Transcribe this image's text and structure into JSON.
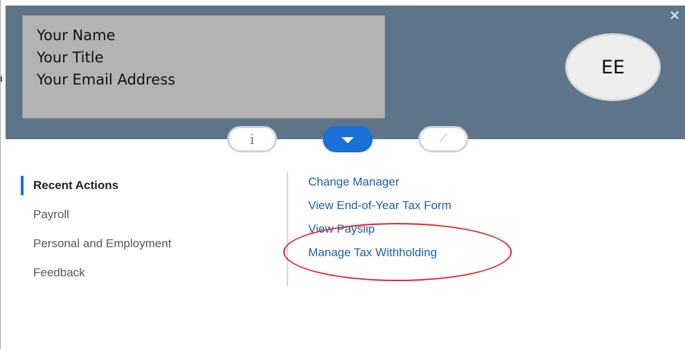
{
  "header": {
    "identity": {
      "name": "Your Name",
      "title": "Your Title",
      "email": "Your Email Address"
    },
    "avatar_initials": "EE",
    "close_symbol": "×"
  },
  "toolbar": {
    "info_symbol": "i",
    "compass_symbol": "⟋"
  },
  "nav": {
    "items": [
      {
        "label": "Recent Actions",
        "active": true
      },
      {
        "label": "Payroll",
        "active": false
      },
      {
        "label": "Personal and Employment",
        "active": false
      },
      {
        "label": "Feedback",
        "active": false
      }
    ]
  },
  "actions": {
    "links": [
      "Change Manager",
      "View End-of-Year Tax Form",
      "View Payslip",
      "Manage Tax Withholding"
    ]
  },
  "colors": {
    "header_bg": "#5d7489",
    "accent": "#1b6fd8",
    "link": "#1a5fa6",
    "annotation": "#e0262a"
  },
  "icons": [
    "close-icon",
    "info-icon",
    "chevron-down-icon",
    "compass-icon"
  ]
}
